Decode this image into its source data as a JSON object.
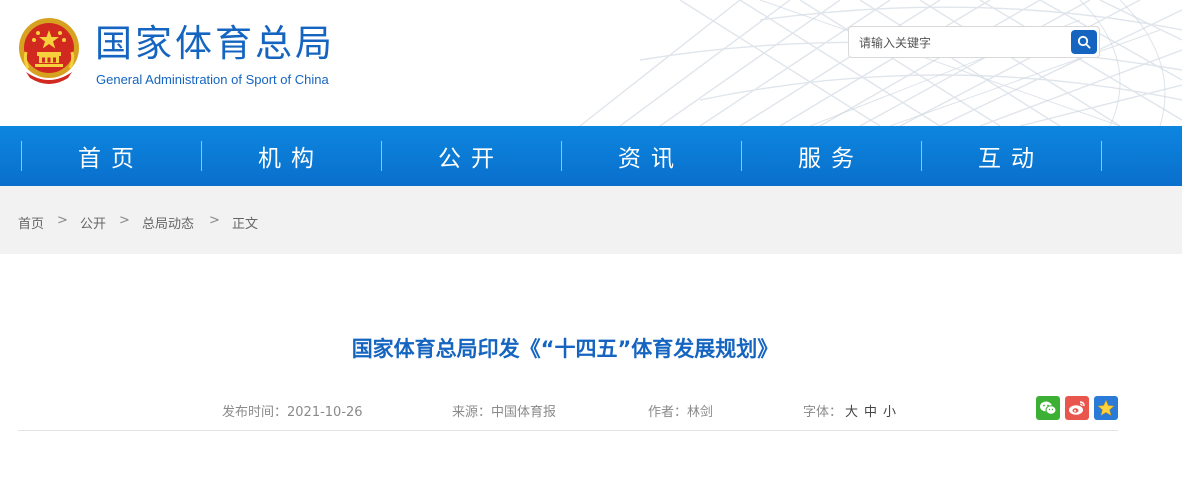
{
  "header": {
    "site_name_cn": "国家体育总局",
    "site_name_en": "General Administration of Sport of China",
    "search_placeholder": "请输入关键字"
  },
  "nav": {
    "items": [
      "首页",
      "机构",
      "公开",
      "资讯",
      "服务",
      "互动"
    ]
  },
  "breadcrumb": {
    "items": [
      "首页",
      "公开",
      "总局动态",
      "正文"
    ],
    "separator": ">"
  },
  "article": {
    "title": "国家体育总局印发《“十四五”体育发展规划》",
    "publish_time": "发布时间：2021-10-26",
    "source": "来源：中国体育报",
    "author": "作者：林剑",
    "font_label": "字体：",
    "font_sizes": [
      "大",
      "中",
      "小"
    ]
  },
  "share": {
    "icons": [
      "wechat-icon",
      "weibo-icon",
      "favorite-star-icon"
    ]
  },
  "colors": {
    "brand_blue": "#1565c0",
    "nav_blue": "#0a78d6",
    "breadcrumb_bg": "#f2f2f2",
    "wechat_green": "#3cb034",
    "weibo_red": "#e8564e",
    "star_blue": "#2a7ad8"
  }
}
